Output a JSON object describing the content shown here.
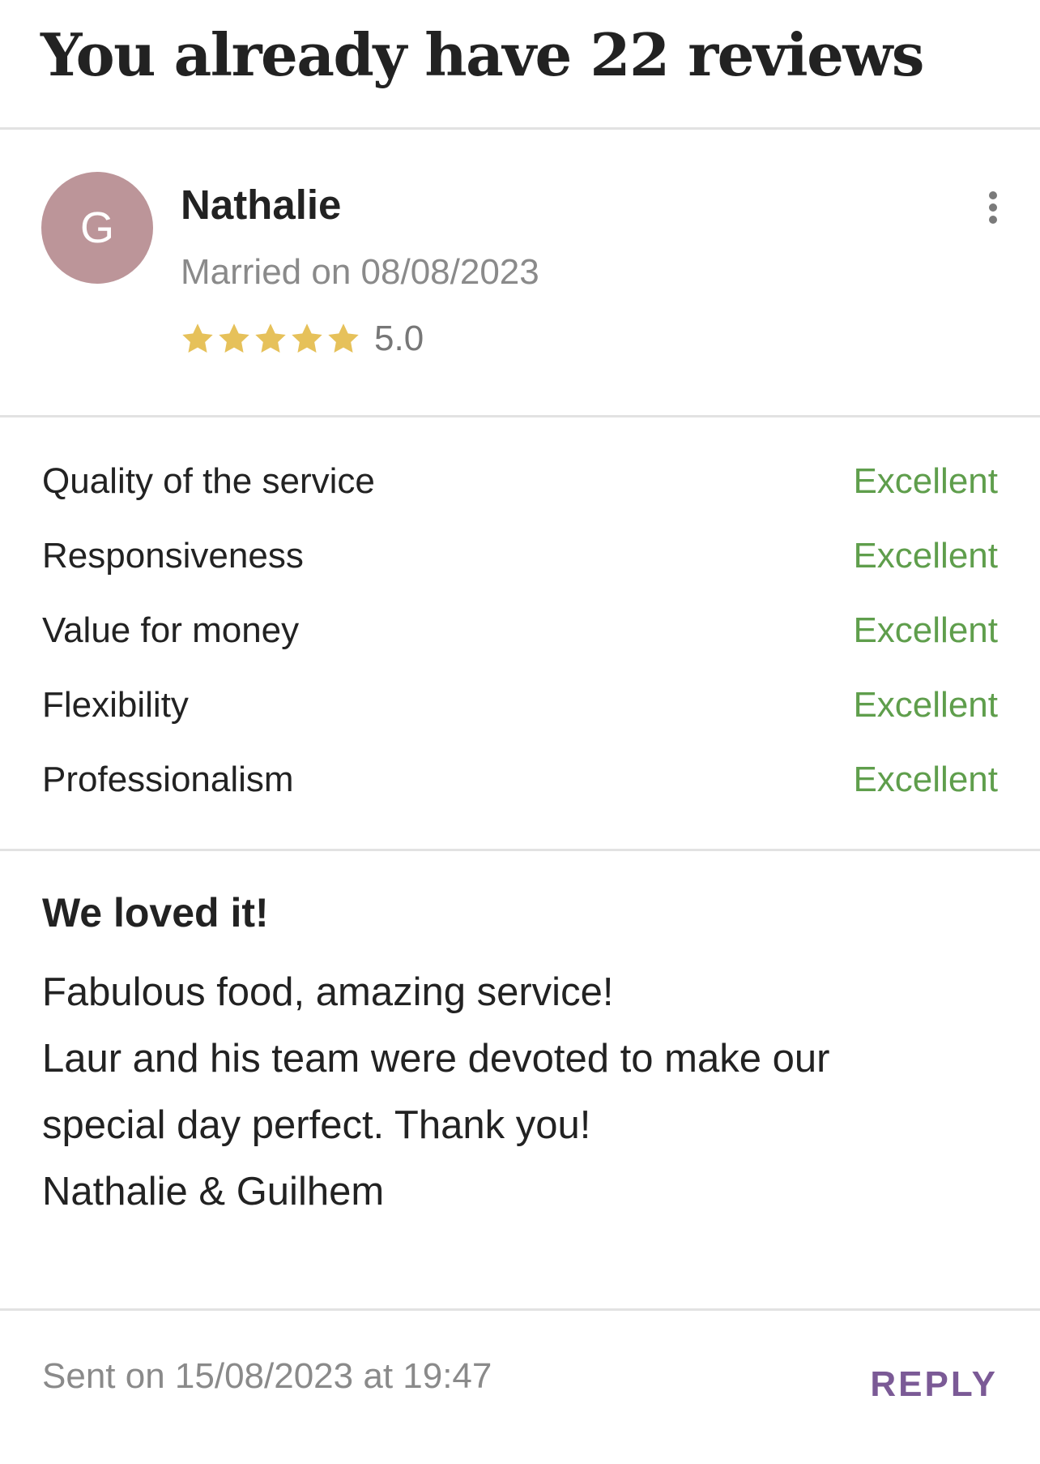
{
  "header": {
    "title": "You already have 22 reviews"
  },
  "review": {
    "avatar_letter": "G",
    "avatar_color": "#bc9599",
    "reviewer_name": "Nathalie",
    "married_on": "Married on 08/08/2023",
    "rating": {
      "value": "5.0",
      "stars_filled": 5,
      "stars_total": 5,
      "star_color": "#e6c15a"
    },
    "more_icon": "more-vertical-icon",
    "criteria": [
      {
        "label": "Quality of the service",
        "value": "Excellent"
      },
      {
        "label": "Responsiveness",
        "value": "Excellent"
      },
      {
        "label": "Value for money",
        "value": "Excellent"
      },
      {
        "label": "Flexibility",
        "value": "Excellent"
      },
      {
        "label": "Professionalism",
        "value": "Excellent"
      }
    ],
    "criteria_value_color": "#5f9e4c",
    "title": "We loved it!",
    "body_lines": [
      "Fabulous food, amazing service!",
      "Laur and his team were devoted to make our",
      "special day perfect. Thank you!",
      "Nathalie & Guilhem"
    ],
    "sent_on": "Sent on 15/08/2023 at 19:47",
    "reply_label": "REPLY",
    "reply_color": "#7b5a96"
  }
}
